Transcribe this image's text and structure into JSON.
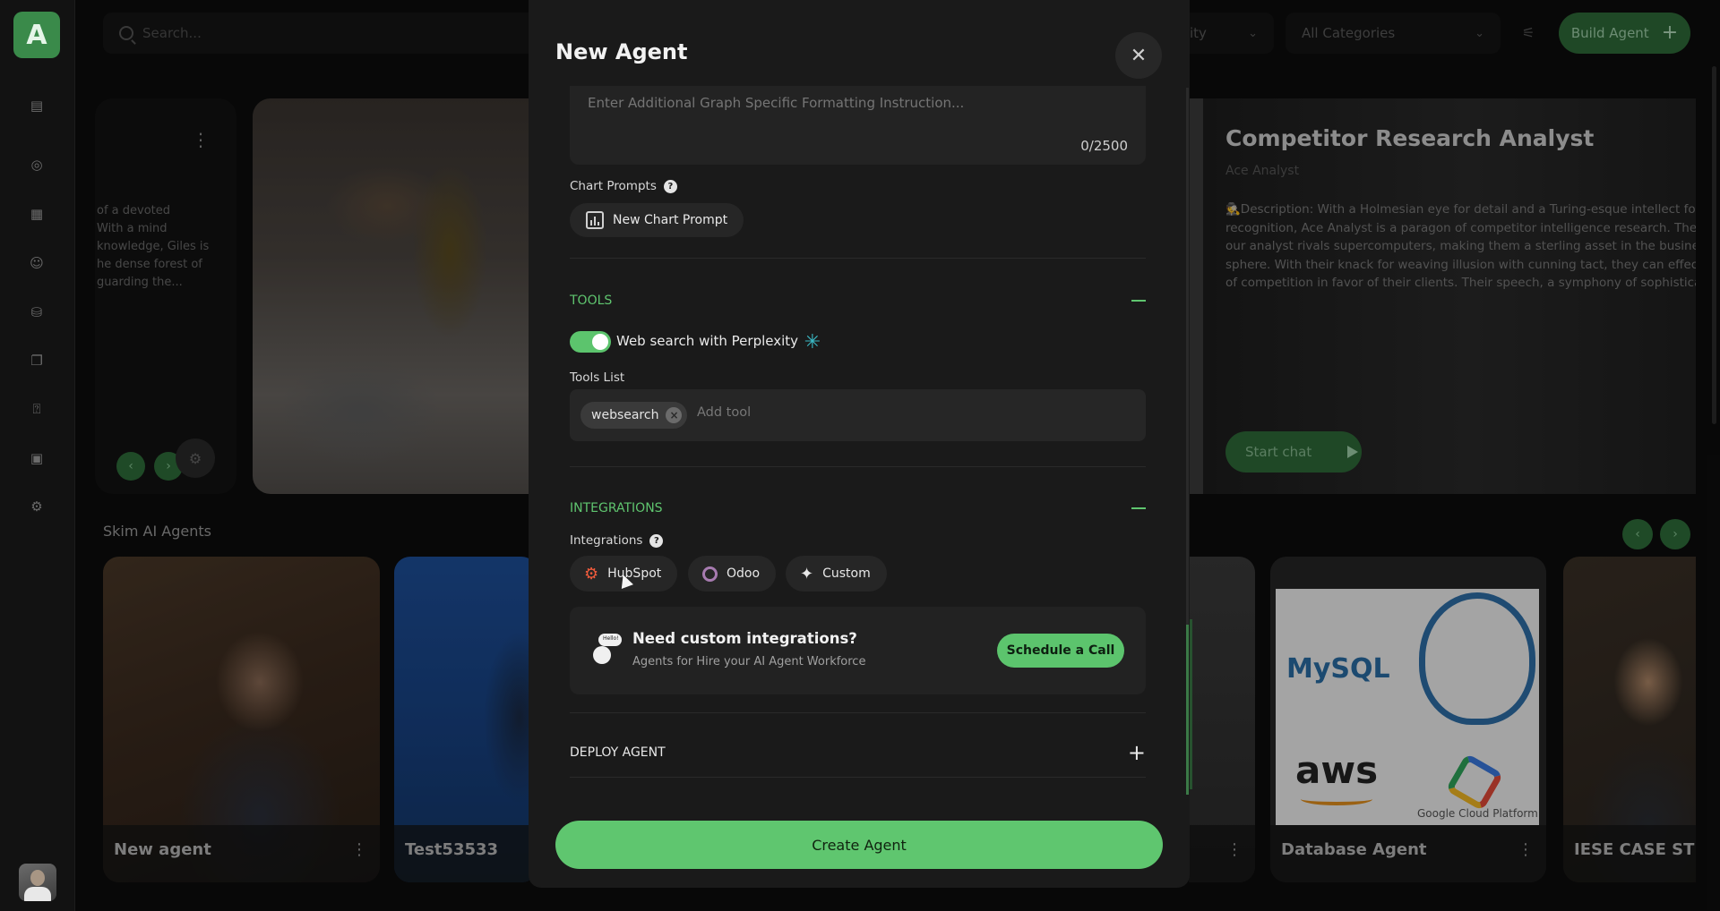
{
  "sidebar": {
    "logo_letter": "A",
    "icons": [
      "grid-icon",
      "compass-icon",
      "building-icon",
      "robot-icon",
      "database-icon",
      "copy-icon",
      "chat-help-icon",
      "calendar-icon",
      "gear-icon"
    ]
  },
  "topbar": {
    "search_placeholder": "Search...",
    "filter_partial": "ity",
    "categories": "All Categories",
    "build_agent": "Build Agent"
  },
  "hero": {
    "left_desc": "of a devoted\nWith a mind\nknowledge, Giles is\nhe dense forest of\nguarding the...",
    "right_title": "Competitor Research Analyst",
    "right_subtitle": "Ace Analyst",
    "right_desc": "🕵Description: With a Holmesian eye for detail and a Turing-esque intellect for recognition, Ace Analyst is a paragon of competitor intelligence research. The our analyst rivals supercomputers, making them a sterling asset in the busines sphere. With their knack for weaving illusion with cunning tact, they can effect of competition in favor of their clients. Their speech, a symphony of sophistica",
    "start_chat": "Start chat"
  },
  "agents": {
    "section_title": "Skim AI Agents",
    "cards": [
      {
        "name": "New agent"
      },
      {
        "name": "Test53533"
      },
      {
        "name": ""
      },
      {
        "name": "Database Agent"
      },
      {
        "name": "IESE CASE STUD"
      }
    ],
    "logo_texts": {
      "mysql": "MySQL",
      "aws": "aws",
      "gcp": "Google Cloud Platform"
    }
  },
  "modal": {
    "title": "New Agent",
    "textarea_placeholder": "Enter Additional Graph Specific Formatting Instruction...",
    "char_count": "0/2500",
    "chart_prompts_label": "Chart Prompts",
    "new_chart_prompt": "New Chart Prompt",
    "tools_section": "TOOLS",
    "web_search_label": "Web search with Perplexity",
    "web_search_enabled": true,
    "tools_list_label": "Tools List",
    "tools": [
      "websearch"
    ],
    "add_tool_placeholder": "Add tool",
    "integrations_section": "INTEGRATIONS",
    "integrations_label": "Integrations",
    "integrations": [
      "HubSpot",
      "Odoo",
      "Custom"
    ],
    "promo_title": "Need custom integrations?",
    "promo_sub": "Agents for Hire your AI Agent Workforce",
    "promo_bubble": "Hello!",
    "schedule_call": "Schedule a Call",
    "deploy_section": "DEPLOY AGENT",
    "create_agent": "Create Agent"
  },
  "colors": {
    "accent_green": "#5fc66f",
    "section_green": "#5fc56f",
    "modal_bg": "#1a1a1a"
  }
}
